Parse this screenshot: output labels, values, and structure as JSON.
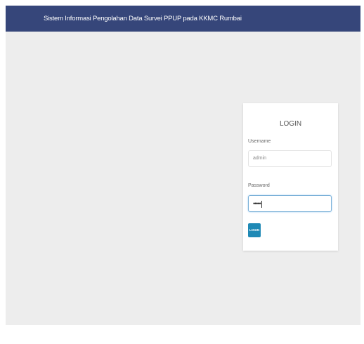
{
  "navbar": {
    "brand": "Sistem Informasi Pengolahan Data Survei PPUP pada KKMC Rumbai"
  },
  "login": {
    "title": "LOGIN",
    "username_label": "Username",
    "username_value": "admin",
    "password_label": "Password",
    "password_value": "•••••",
    "button_label": "LOGIN"
  }
}
